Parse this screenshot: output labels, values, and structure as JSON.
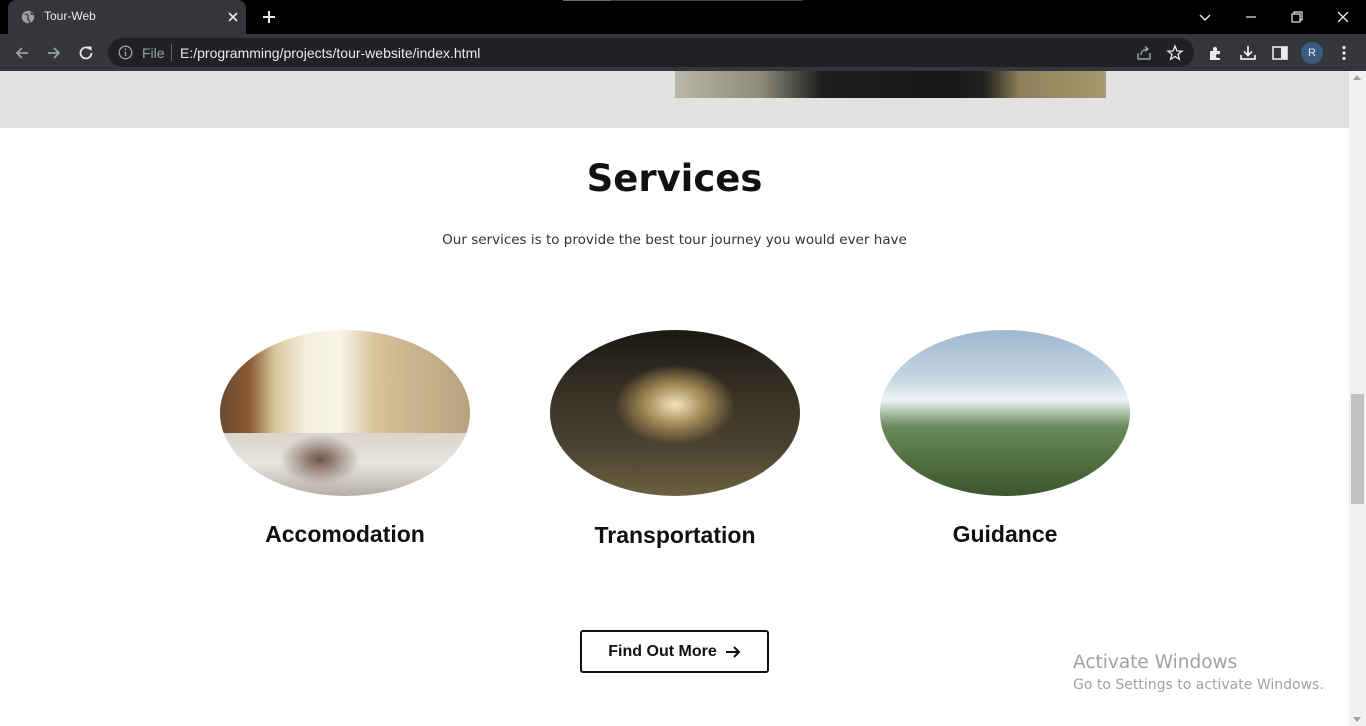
{
  "browser": {
    "tab": {
      "title": "Tour-Web"
    },
    "omnibox": {
      "scheme_label": "File",
      "url": "E:/programming/projects/tour-website/index.html"
    },
    "profile_initial": "R"
  },
  "page": {
    "services": {
      "title": "Services",
      "subtitle": "Our services is to provide the best tour journey you would ever have",
      "cards": [
        {
          "label": "Accomodation"
        },
        {
          "label": "Transportation"
        },
        {
          "label": "Guidance"
        }
      ],
      "cta_label": "Find Out More"
    }
  },
  "os_watermark": {
    "title": "Activate Windows",
    "subtitle": "Go to Settings to activate Windows."
  }
}
